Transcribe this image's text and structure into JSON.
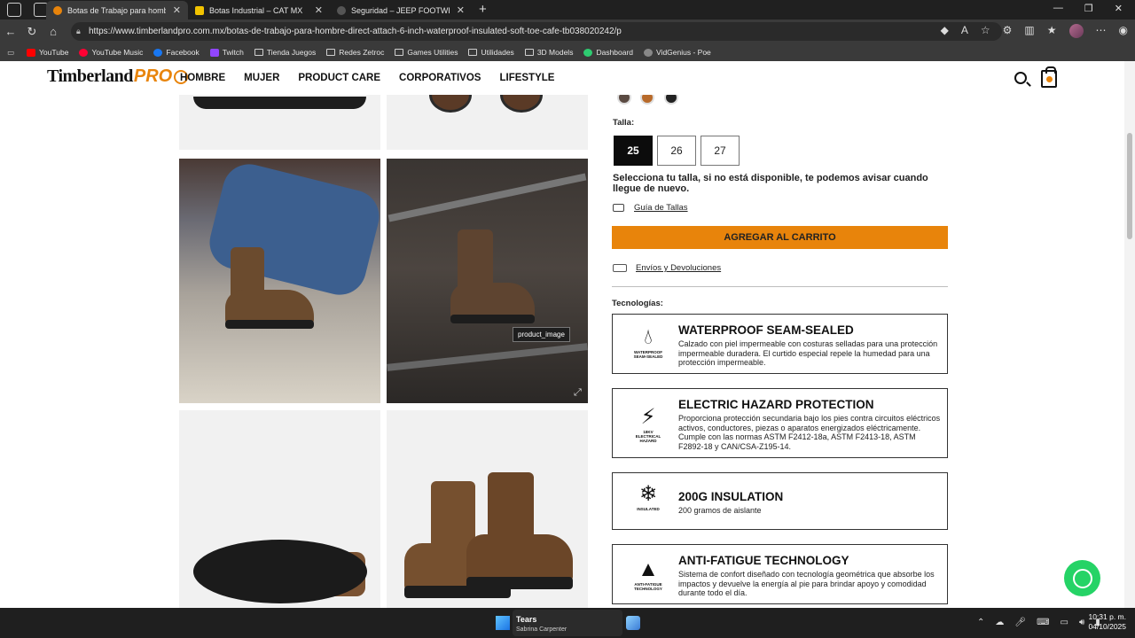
{
  "browser": {
    "tabs": [
      {
        "title": "Botas de Trabajo para hombre Di",
        "active": true,
        "favicon_color": "#e8840b"
      },
      {
        "title": "Botas Industrial – CAT MX",
        "active": false,
        "favicon_color": "#f2c300"
      },
      {
        "title": "Seguridad – JEEP FOOTWEAR",
        "active": false,
        "favicon_color": "#555555"
      }
    ],
    "url": "https://www.timberlandpro.com.mx/botas-de-trabajo-para-hombre-direct-attach-6-inch-waterproof-insulated-soft-toe-cafe-tb038020242/p",
    "bookmarks": [
      {
        "label": "YouTube",
        "icon": "youtube-icon",
        "color": "#ff0000"
      },
      {
        "label": "YouTube Music",
        "icon": "youtube-music-icon",
        "color": "#ff0033"
      },
      {
        "label": "Facebook",
        "icon": "facebook-icon",
        "color": "#1877f2"
      },
      {
        "label": "Twitch",
        "icon": "twitch-icon",
        "color": "#9146ff"
      },
      {
        "label": "Tienda Juegos",
        "icon": "folder-icon"
      },
      {
        "label": "Redes Zetroc",
        "icon": "folder-icon"
      },
      {
        "label": "Games Utilities",
        "icon": "folder-icon"
      },
      {
        "label": "Utilidades",
        "icon": "folder-icon"
      },
      {
        "label": "3D Models",
        "icon": "folder-icon"
      },
      {
        "label": "Dashboard",
        "icon": "dashboard-icon",
        "color": "#2ecc71"
      },
      {
        "label": "VidGenius - Poe",
        "icon": "poe-icon",
        "color": "#888888"
      }
    ]
  },
  "site": {
    "logo_text": "Timberland",
    "logo_pro": "PRO",
    "nav": [
      "HOMBRE",
      "MUJER",
      "PRODUCT CARE",
      "CORPORATIVOS",
      "LIFESTYLE"
    ]
  },
  "gallery": {
    "tooltip": "product_image"
  },
  "product": {
    "swatches": [
      "#5a4a42",
      "#b86a2a",
      "#222222"
    ],
    "size_label": "Talla:",
    "sizes": [
      "25",
      "26",
      "27"
    ],
    "selected_size": "25",
    "size_note": "Selecciona tu talla, si no está disponible, te podemos avisar cuando llegue de nuevo.",
    "size_guide": "Guía de Tallas",
    "add_to_cart": "AGREGAR AL CARRITO",
    "shipping": "Envíos y Devoluciones",
    "tech_title": "Tecnologías:",
    "technologies": [
      {
        "name": "WATERPROOF SEAM-SEALED",
        "icon": "waterproof-drop-icon",
        "icon_caption": "WATERPROOF SEAM-SEALED",
        "description": "Calzado con piel impermeable con costuras selladas para una protección impermeable duradera. El curtido especial repele la humedad para una protección impermeable."
      },
      {
        "name": "ELECTRIC HAZARD PROTECTION",
        "icon": "lightning-icon",
        "icon_caption": "18KV ELECTRICAL HAZARD",
        "description": "Proporciona protección secundaria bajo los pies contra circuitos eléctricos activos, conductores, piezas o aparatos energizados eléctricamente. Cumple con las normas ASTM F2412-18a, ASTM F2413-18, ASTM F2892-18 y CAN/CSA-Z195-14."
      },
      {
        "name": "200G INSULATION",
        "icon": "snowflake-icon",
        "icon_caption": "INSULATED",
        "description": "200 gramos de aislante"
      },
      {
        "name": "ANTI-FATIGUE TECHNOLOGY",
        "icon": "anti-fatigue-icon",
        "icon_caption": "ANTI-FATIGUE TECHNOLOGY",
        "description": "Sistema de confort diseñado con tecnología geométrica que absorbe los impactos y devuelve la energía al pie para brindar apoyo y comodidad durante todo el día."
      }
    ]
  },
  "taskbar": {
    "song": "Tears",
    "artist": "Sabrina Carpenter",
    "time": "10:31 p. m.",
    "date": "04/10/2025"
  }
}
